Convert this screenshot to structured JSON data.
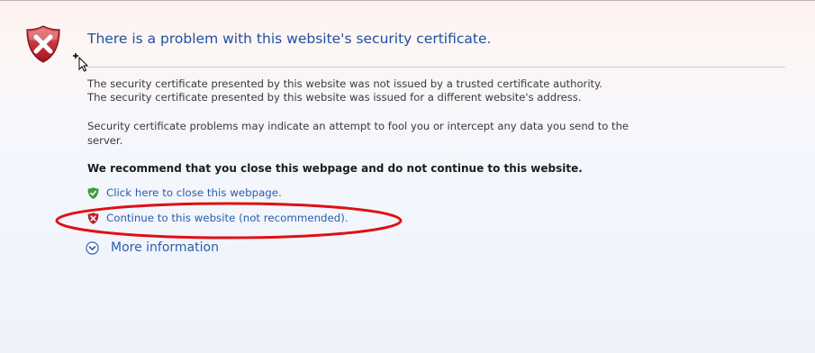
{
  "page": {
    "title": "There is a problem with this website's security certificate.",
    "details": [
      "The security certificate presented by this website was not issued by a trusted certificate authority.",
      "The security certificate presented by this website was issued for a different website's address."
    ],
    "warning_line1": "Security certificate problems may indicate an attempt to fool you or intercept any data you send to the",
    "warning_line2": "server.",
    "recommendation": "We recommend that you close this webpage and do not continue to this website."
  },
  "links": {
    "close": "Click here to close this webpage.",
    "continue": "Continue to this website (not recommended).",
    "more_info": "More information"
  },
  "icons": {
    "error": "error-shield-icon",
    "close_link": "green-shield-check-icon",
    "continue_link": "red-shield-x-icon",
    "more_info": "expand-chevron-circle-icon"
  },
  "colors": {
    "title": "#1f4f9e",
    "link": "#2a5ea8",
    "error_red": "#c8202a",
    "ok_green": "#3aa335",
    "annotation_red": "#e01010"
  }
}
